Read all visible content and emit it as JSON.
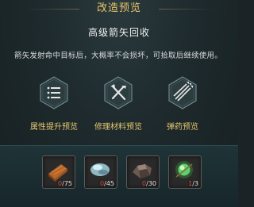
{
  "header": {
    "title": "改造预览"
  },
  "weapon": {
    "name": "高级箭矢回收",
    "description": "箭矢发射命中目标后，大概率不会损坏，可拾取后继续使用。"
  },
  "options": [
    {
      "label": "属性提升预览",
      "icon": "list-icon"
    },
    {
      "label": "修理材料预览",
      "icon": "tools-icon"
    },
    {
      "label": "弹药预览",
      "icon": "arrows-icon"
    }
  ],
  "materials": [
    {
      "icon": "wood-plank-icon",
      "have": "0",
      "need": "/75"
    },
    {
      "icon": "crystal-ore-icon",
      "have": "0",
      "need": "/45"
    },
    {
      "icon": "stone-ore-icon",
      "have": "0",
      "need": "/30"
    },
    {
      "icon": "green-gem-icon",
      "have": "1",
      "need": "/3"
    }
  ]
}
